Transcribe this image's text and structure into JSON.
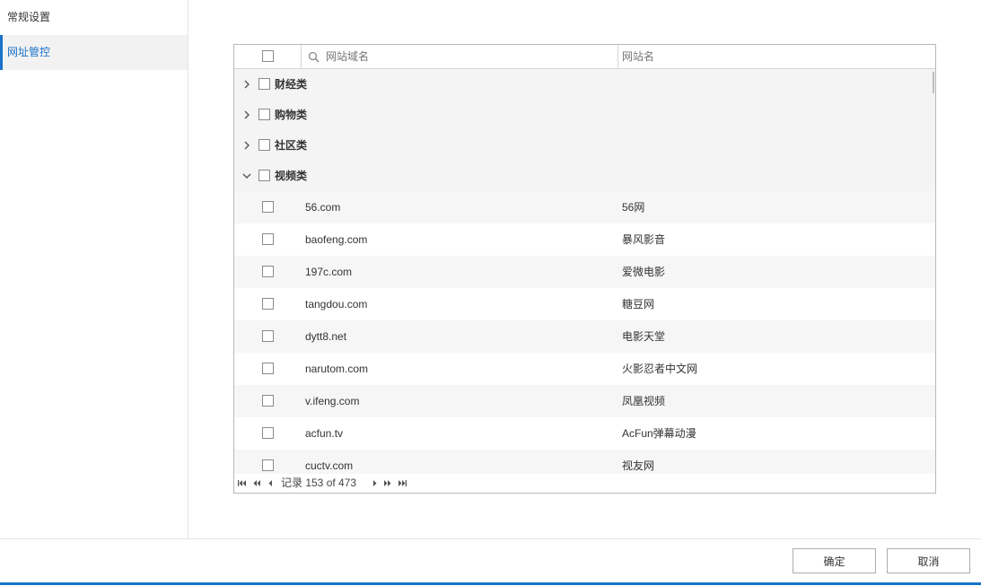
{
  "sidebar": {
    "items": [
      {
        "label": "常规设置"
      },
      {
        "label": "网址管控"
      }
    ]
  },
  "grid": {
    "header": {
      "domain_placeholder": "网站域名",
      "name_label": "网站名"
    },
    "groups": [
      {
        "label": "财经类",
        "expanded": false
      },
      {
        "label": "购物类",
        "expanded": false
      },
      {
        "label": "社区类",
        "expanded": false
      },
      {
        "label": "视频类",
        "expanded": true
      }
    ],
    "rows": [
      {
        "domain": "56.com",
        "name": "56网"
      },
      {
        "domain": "baofeng.com",
        "name": "暴风影音"
      },
      {
        "domain": "197c.com",
        "name": "爱微电影"
      },
      {
        "domain": "tangdou.com",
        "name": "糖豆网"
      },
      {
        "domain": "dytt8.net",
        "name": "电影天堂"
      },
      {
        "domain": "narutom.com",
        "name": "火影忍者中文网"
      },
      {
        "domain": "v.ifeng.com",
        "name": "凤凰视频"
      },
      {
        "domain": "acfun.tv",
        "name": "AcFun弹幕动漫"
      },
      {
        "domain": "cuctv.com",
        "name": "视友网"
      }
    ],
    "pager": {
      "record_text": "记录 153 of 473"
    }
  },
  "footer": {
    "confirm_label": "确定",
    "cancel_label": "取消"
  },
  "colors": {
    "accent": "#1a73c9",
    "group_bg": "#f4f4f4",
    "alt_row_bg": "#f6f6f6"
  },
  "icons": {
    "search": "search-icon",
    "expand": "chevron-right-icon",
    "collapse": "chevron-down-icon",
    "pager": [
      "first-page-icon",
      "fast-back-icon",
      "prev-page-icon",
      "next-page-icon",
      "fast-forward-icon",
      "last-page-icon"
    ]
  }
}
